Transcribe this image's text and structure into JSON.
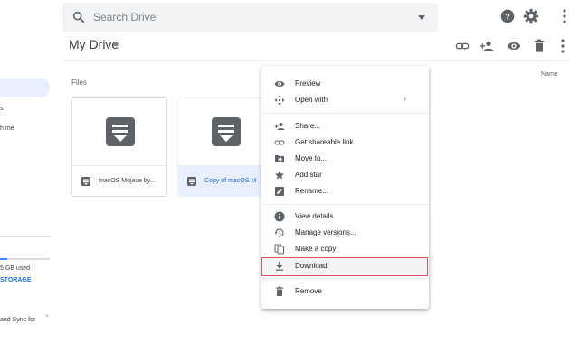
{
  "search": {
    "placeholder": "Search Drive"
  },
  "header": {
    "title": "My Drive"
  },
  "content": {
    "files_label": "Files",
    "sort_label": "Name"
  },
  "sidebar_fragments": {
    "item_shared": "h me",
    "storage_used": "5 GB used",
    "upgrade": "STORAGE",
    "promo": "and Sync for",
    "close": "×"
  },
  "files": [
    {
      "name": "macOS Mojave by..."
    },
    {
      "name": "Copy of macOS M"
    }
  ],
  "menu": {
    "items": [
      {
        "label": "Preview",
        "icon": "eye-icon"
      },
      {
        "label": "Open with",
        "icon": "open-with-icon",
        "submenu": "›"
      },
      {
        "label": "Share...",
        "icon": "person-add-icon"
      },
      {
        "label": "Get shareable link",
        "icon": "link-icon"
      },
      {
        "label": "Move to...",
        "icon": "folder-move-icon"
      },
      {
        "label": "Add star",
        "icon": "star-icon"
      },
      {
        "label": "Rename...",
        "icon": "edit-icon"
      },
      {
        "label": "View details",
        "icon": "info-icon"
      },
      {
        "label": "Manage versions...",
        "icon": "history-icon"
      },
      {
        "label": "Make a copy",
        "icon": "copy-icon"
      },
      {
        "label": "Download",
        "icon": "download-icon"
      },
      {
        "label": "Remove",
        "icon": "trash-icon"
      }
    ]
  },
  "colors": {
    "accent": "#1a73e8",
    "highlight_border": "#e0555d",
    "icon_gray": "#5f6368"
  }
}
